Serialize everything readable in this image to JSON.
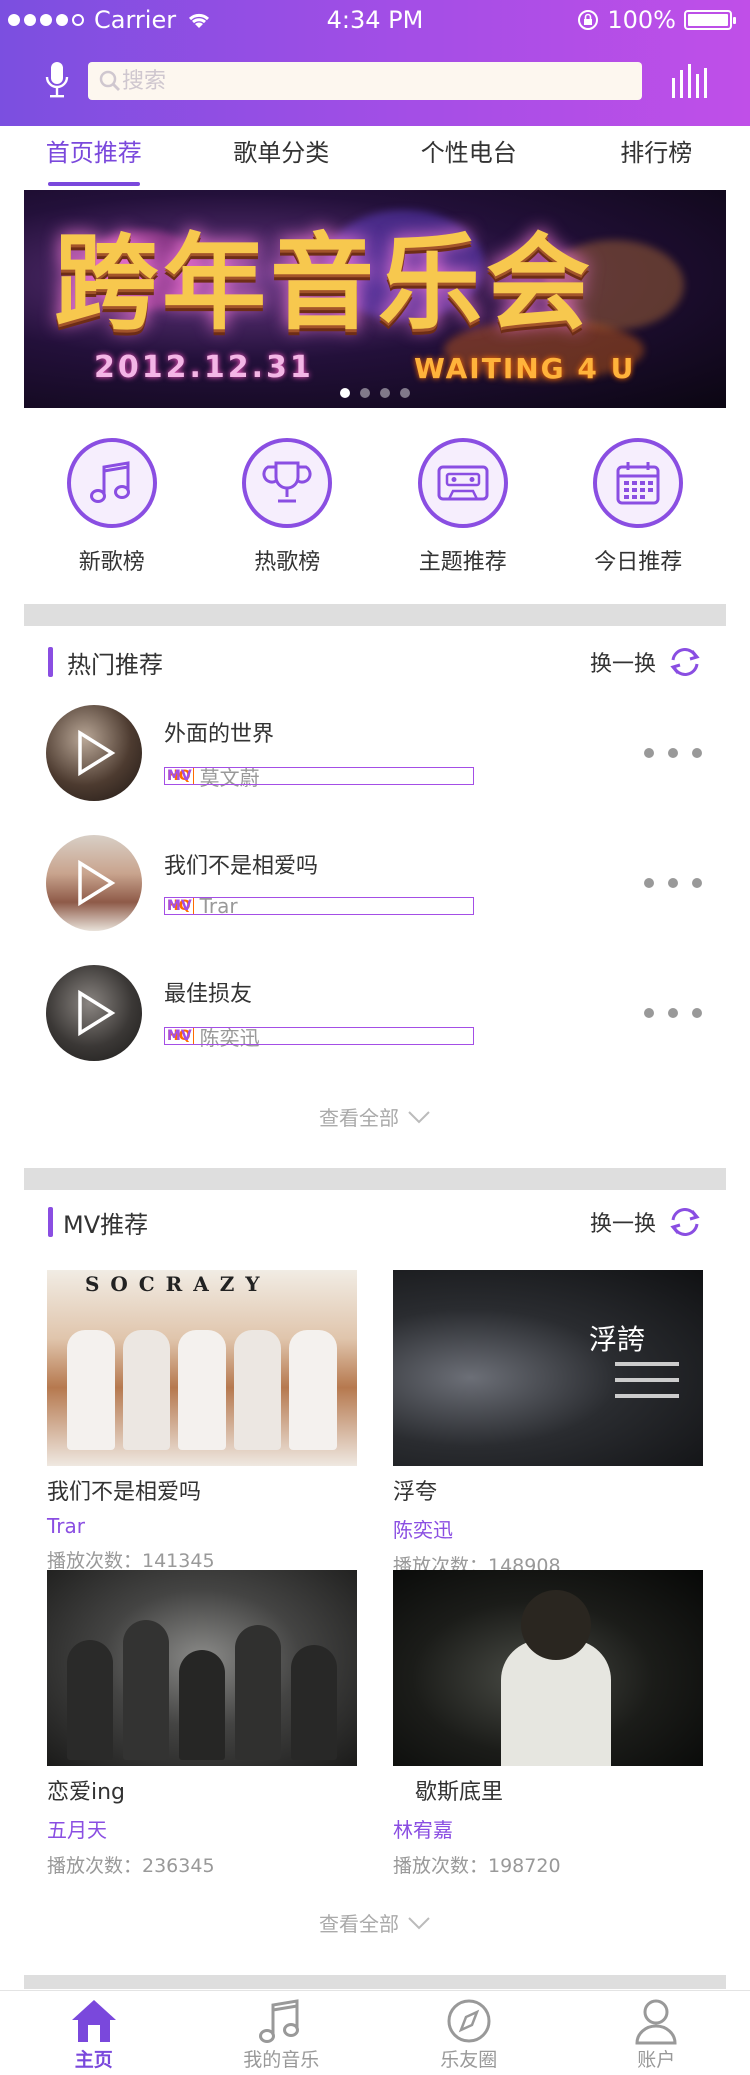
{
  "status_bar": {
    "carrier": "Carrier",
    "time": "4:34 PM",
    "battery": "100%"
  },
  "search": {
    "placeholder": "搜索"
  },
  "tabs": [
    {
      "label": "首页推荐",
      "active": true
    },
    {
      "label": "歌单分类",
      "active": false
    },
    {
      "label": "个性电台",
      "active": false
    },
    {
      "label": "排行榜",
      "active": false
    }
  ],
  "banner": {
    "title": "跨年音乐会",
    "date": "2012.12.31",
    "tagline": "WAITING 4 U"
  },
  "quick_nav": [
    {
      "label": "新歌榜",
      "icon": "music-note-icon"
    },
    {
      "label": "热歌榜",
      "icon": "trophy-icon"
    },
    {
      "label": "主题推荐",
      "icon": "cassette-icon"
    },
    {
      "label": "今日推荐",
      "icon": "calendar-icon"
    }
  ],
  "hot": {
    "title": "热门推荐",
    "refresh_label": "换一换",
    "view_all": "查看全部",
    "songs": [
      {
        "name": "外面的世界",
        "hq": "HQ",
        "mv": "MV",
        "artist": "莫文蔚"
      },
      {
        "name": "我们不是相爱吗",
        "hq": "HQ",
        "mv": "MV",
        "artist": "Trar"
      },
      {
        "name": "最佳损友",
        "hq": "HQ",
        "mv": "MV",
        "artist": "陈奕迅"
      }
    ]
  },
  "mv": {
    "title": "MV推荐",
    "refresh_label": "换一换",
    "view_all": "查看全部",
    "items": [
      {
        "title": "我们不是相爱吗",
        "artist": "Trar",
        "plays": "播放次数：141345",
        "thumb_text": "S O C R A Z Y"
      },
      {
        "title": "浮夸",
        "artist": "陈奕迅",
        "plays": "播放次数：148908",
        "thumb_text": "浮誇"
      },
      {
        "title": "恋爱ing",
        "artist": "五月天",
        "plays": "播放次数：236345",
        "thumb_text": ""
      },
      {
        "title": "　歇斯底里",
        "artist": "林宥嘉",
        "plays": "播放次数：198720",
        "thumb_text": ""
      }
    ]
  },
  "tabbar": [
    {
      "label": "主页",
      "active": true,
      "icon": "home-icon"
    },
    {
      "label": "我的音乐",
      "active": false,
      "icon": "music-note-icon"
    },
    {
      "label": "乐友圈",
      "active": false,
      "icon": "compass-icon"
    },
    {
      "label": "账户",
      "active": false,
      "icon": "user-icon"
    }
  ],
  "colors": {
    "accent": "#7a48dc",
    "header_start": "#7b4fe0",
    "header_end": "#c04fe8",
    "hq_badge": "#ff6a00",
    "mv_badge": "#a44ee6"
  }
}
